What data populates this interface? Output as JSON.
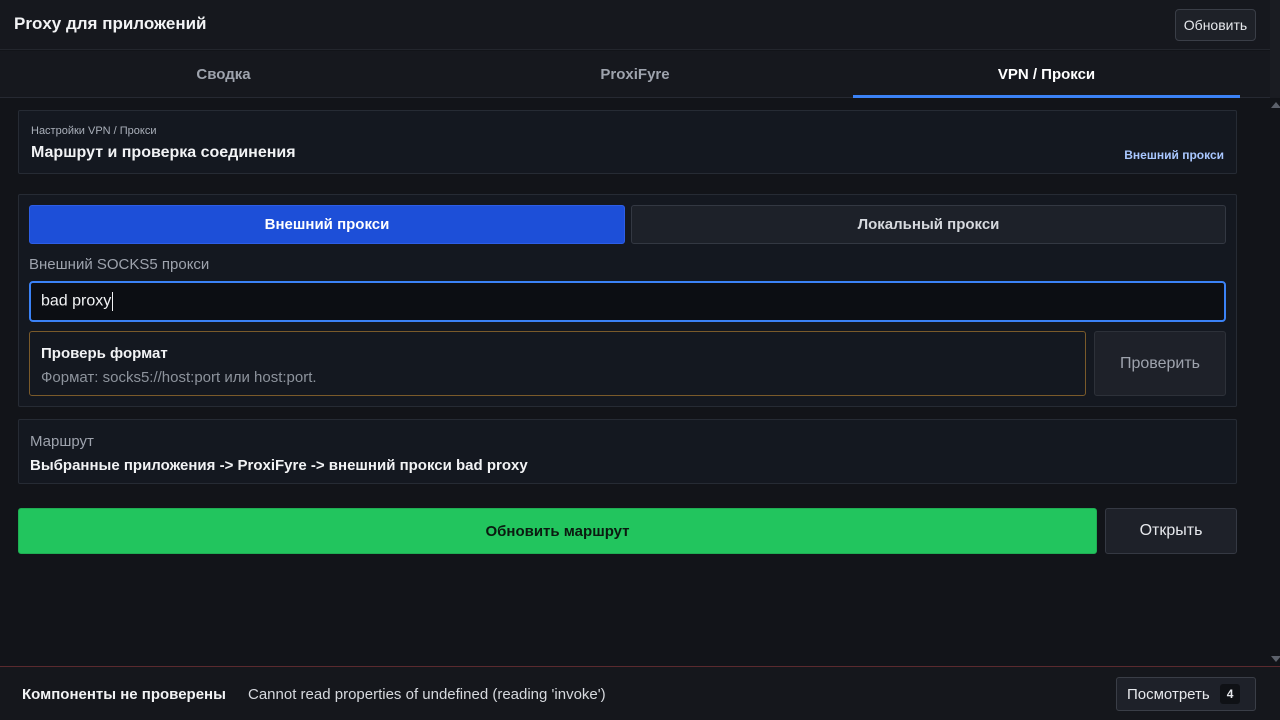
{
  "header": {
    "title": "Proxy для приложений",
    "refresh_label": "Обновить"
  },
  "tabs": [
    {
      "label": "Сводка",
      "active": false
    },
    {
      "label": "ProxiFyre",
      "active": false
    },
    {
      "label": "VPN / Прокси",
      "active": true
    }
  ],
  "settings": {
    "subtitle": "Настройки VPN / Прокси",
    "title": "Маршрут и проверка соединения",
    "mode_badge": "Внешний прокси"
  },
  "proxy": {
    "mode_external": "Внешний прокси",
    "mode_local": "Локальный прокси",
    "selected_mode": "Внешний прокси",
    "field_label": "Внешний SOCKS5 прокси",
    "input_value": "bad proxy",
    "warning_title": "Проверь формат",
    "warning_text": "Формат: socks5://host:port или host:port.",
    "check_label": "Проверить"
  },
  "route": {
    "label": "Маршрут",
    "value": "Выбранные приложения -> ProxiFyre -> внешний прокси bad proxy"
  },
  "actions": {
    "update_label": "Обновить маршрут",
    "open_label": "Открыть"
  },
  "status": {
    "title": "Компоненты не проверены",
    "message": "Cannot read properties of undefined (reading 'invoke')",
    "view_label": "Посмотреть",
    "count": "4"
  },
  "colors": {
    "accent": "#3b82f6",
    "primary_button": "#1d4fd8",
    "success": "#22c55e",
    "warning_border": "#7a5a2a",
    "error_border": "#5a2a2e"
  }
}
